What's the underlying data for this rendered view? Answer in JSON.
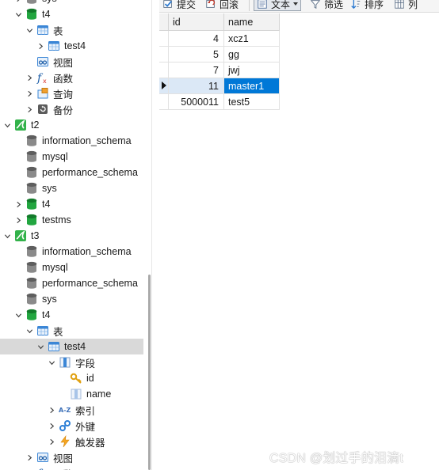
{
  "tree": {
    "items": [
      {
        "label": "sys",
        "icon": "database-icon-gray",
        "expander": "right"
      },
      {
        "label": "t4",
        "icon": "database-icon-green",
        "expander": "down"
      },
      {
        "label": "表",
        "icon": "tables-folder-icon",
        "expander": "down"
      },
      {
        "label": "test4",
        "icon": "table-icon",
        "expander": "right"
      },
      {
        "label": "视图",
        "icon": "views-icon",
        "expander": "none"
      },
      {
        "label": "函数",
        "icon": "function-icon",
        "expander": "right"
      },
      {
        "label": "查询",
        "icon": "query-icon",
        "expander": "right"
      },
      {
        "label": "备份",
        "icon": "backup-icon",
        "expander": "right"
      },
      {
        "label": "t2",
        "icon": "mysql-connection-icon",
        "expander": "down"
      },
      {
        "label": "information_schema",
        "icon": "database-icon-gray",
        "expander": "none"
      },
      {
        "label": "mysql",
        "icon": "database-icon-gray",
        "expander": "none"
      },
      {
        "label": "performance_schema",
        "icon": "database-icon-gray",
        "expander": "none"
      },
      {
        "label": "sys",
        "icon": "database-icon-gray",
        "expander": "none"
      },
      {
        "label": "t4",
        "icon": "database-icon-green",
        "expander": "right"
      },
      {
        "label": "testms",
        "icon": "database-icon-green",
        "expander": "right"
      },
      {
        "label": "t3",
        "icon": "mysql-connection-icon",
        "expander": "down"
      },
      {
        "label": "information_schema",
        "icon": "database-icon-gray",
        "expander": "none"
      },
      {
        "label": "mysql",
        "icon": "database-icon-gray",
        "expander": "none"
      },
      {
        "label": "performance_schema",
        "icon": "database-icon-gray",
        "expander": "none"
      },
      {
        "label": "sys",
        "icon": "database-icon-gray",
        "expander": "none"
      },
      {
        "label": "t4",
        "icon": "database-icon-green",
        "expander": "down"
      },
      {
        "label": "表",
        "icon": "tables-folder-icon",
        "expander": "down"
      },
      {
        "label": "test4",
        "icon": "table-icon",
        "expander": "down",
        "selected": true
      },
      {
        "label": "字段",
        "icon": "fields-icon",
        "expander": "down"
      },
      {
        "label": "id",
        "icon": "primary-key-icon",
        "expander": "none"
      },
      {
        "label": "name",
        "icon": "column-icon",
        "expander": "none"
      },
      {
        "label": "索引",
        "icon": "index-icon",
        "expander": "right"
      },
      {
        "label": "外键",
        "icon": "foreign-key-icon",
        "expander": "right"
      },
      {
        "label": "触发器",
        "icon": "trigger-icon",
        "expander": "right"
      },
      {
        "label": "视图",
        "icon": "views-icon",
        "expander": "right"
      },
      {
        "label": "函数",
        "icon": "function-icon",
        "expander": "right"
      }
    ]
  },
  "toolbar": {
    "commit_label": "提交",
    "rollback_label": "回滚",
    "text_label": "文本",
    "filter_label": "筛选",
    "sort_label": "排序",
    "columns_label": "列"
  },
  "grid": {
    "columns": [
      "id",
      "name"
    ],
    "rows": [
      {
        "id": "4",
        "name": "xcz1"
      },
      {
        "id": "5",
        "name": "gg"
      },
      {
        "id": "7",
        "name": "jwj"
      },
      {
        "id": "11",
        "name": "master1",
        "selected": true
      },
      {
        "id": "5000011",
        "name": "test5"
      }
    ]
  },
  "watermark": "CSDN @划过手的泪滴t",
  "colors": {
    "selection_blue": "#0078d7",
    "row_highlight": "#dbe8f6",
    "db_green": "#1e9c3a",
    "db_gray": "#7a7a7a"
  }
}
